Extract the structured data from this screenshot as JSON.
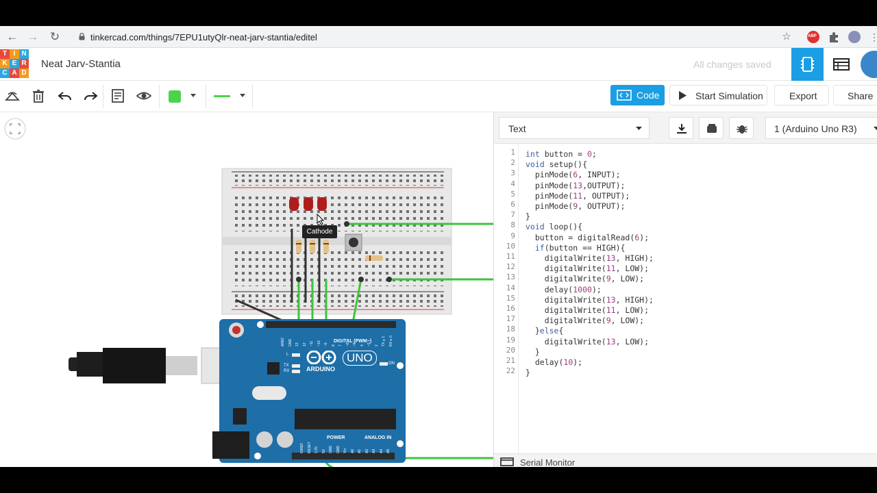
{
  "browser": {
    "url": "tinkercad.com/things/7EPU1utyQlr-neat-jarv-stantia/editel"
  },
  "app": {
    "logo_letters": [
      "T",
      "I",
      "N",
      "K",
      "E",
      "R",
      "C",
      "A",
      "D"
    ],
    "logo_colors": [
      "#e44b3c",
      "#f49b1c",
      "#2aa7e0",
      "#f49b1c",
      "#2aa7e0",
      "#e44b3c",
      "#2aa7e0",
      "#e44b3c",
      "#f49b1c"
    ],
    "project_name": "Neat Jarv-Stantia",
    "save_status": "All changes saved",
    "accent_color": "#1b9ee3"
  },
  "toolbar": {
    "code_label": "Code",
    "start_simulation_label": "Start Simulation",
    "export_label": "Export",
    "share_label": "Share",
    "fill_color": "#4bd34b",
    "wire_color": "#4bd34b"
  },
  "code_panel": {
    "mode": "Text",
    "board": "1 (Arduino Uno R3)",
    "serial_monitor_label": "Serial Monitor",
    "line_numbers": [
      "1",
      "2",
      "3",
      "4",
      "5",
      "6",
      "7",
      "8",
      "9",
      "10",
      "11",
      "12",
      "13",
      "14",
      "15",
      "16",
      "17",
      "18",
      "19",
      "20",
      "21",
      "22"
    ],
    "lines": [
      "int button = 0;",
      "void setup(){",
      "  pinMode(6, INPUT);",
      "  pinMode(13,OUTPUT);",
      "  pinMode(11, OUTPUT);",
      "  pinMode(9, OUTPUT);",
      "}",
      "void loop(){",
      "  button = digitalRead(6);",
      "  if(button == HIGH){",
      "    digitalWrite(13, HIGH);",
      "    digitalWrite(11, LOW);",
      "    digitalWrite(9, LOW);",
      "    delay(1000);",
      "    digitalWrite(13, HIGH);",
      "    digitalWrite(11, LOW);",
      "    digitalWrite(9, LOW);",
      "  }else{",
      "    digitalWrite(13, LOW);",
      "  }",
      "  delay(10);",
      "}"
    ]
  },
  "canvas": {
    "tooltip": "Cathode",
    "board_brand": "ARDUINO",
    "board_model": "UNO",
    "digital_label": "DIGITAL (PWM~)",
    "power_label": "POWER",
    "analog_label": "ANALOG IN",
    "led_labels": [
      "L",
      "TX",
      "RX"
    ],
    "on_label": "ON",
    "header_labels_top": [
      "AREF",
      "GND",
      "13",
      "12",
      "~11",
      "~10",
      "~9",
      "8",
      "7",
      "~6",
      "~5",
      "4",
      "~3",
      "2",
      "TX▸1",
      "RX◂0"
    ],
    "header_labels_bottom": [
      "IOREF",
      "RESET",
      "3.3V",
      "5V",
      "GND",
      "GND",
      "Vin",
      "A0",
      "A1",
      "A2",
      "A3",
      "A4",
      "A5"
    ]
  }
}
